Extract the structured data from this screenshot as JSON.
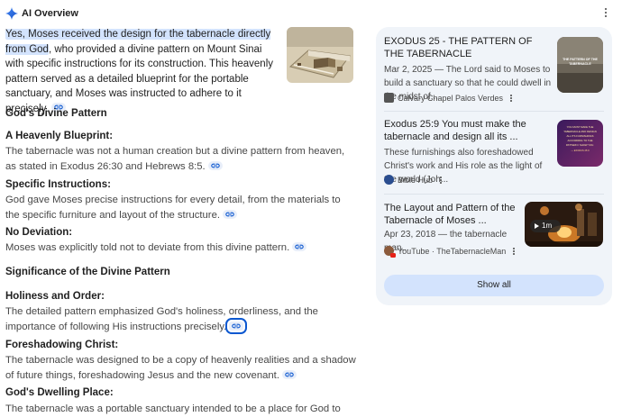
{
  "header": {
    "title": "AI Overview"
  },
  "intro": {
    "highlight": "Yes, Moses received the design for the tabernacle directly from God",
    "rest": ", who provided a divine pattern on Mount Sinai with specific instructions for its construction. This heavenly pattern served as a detailed blueprint for the portable sanctuary, and Moses was instructed to adhere to it precisely."
  },
  "sections": {
    "divine_pattern": {
      "heading": "God's Divine Pattern",
      "items": [
        {
          "title": "A Heavenly Blueprint:",
          "text": "The tabernacle was not a human creation but a divine pattern from heaven, as stated in Exodus 26:30 and Hebrews 8:5."
        },
        {
          "title": "Specific Instructions:",
          "text": "God gave Moses precise instructions for every detail, from the materials to the specific furniture and layout of the structure."
        },
        {
          "title": "No Deviation:",
          "text": "Moses was explicitly told not to deviate from this divine pattern."
        }
      ]
    },
    "significance": {
      "heading": "Significance of the Divine Pattern",
      "items": [
        {
          "title": "Holiness and Order:",
          "text": "The detailed pattern emphasized God's holiness, orderliness, and the importance of following His instructions precisely."
        },
        {
          "title": "Foreshadowing Christ:",
          "text": "The tabernacle was designed to be a copy of heavenly realities and a shadow of future things, foreshadowing Jesus and the new covenant."
        },
        {
          "title": "God's Dwelling Place:",
          "text": "The tabernacle was a portable sanctuary intended to be a place for God to dwell in the"
        }
      ]
    }
  },
  "sources": {
    "cards": [
      {
        "title": "EXODUS 25 - THE PATTERN OF THE TABERNACLE",
        "snippet": "Mar 2, 2025 — The Lord said to Moses to build a sanctuary so that he could dwell in the midst of...",
        "source": "Calvary Chapel Palos Verdes",
        "thumb_text": "THE PATTERN OF THE TABERNACLE"
      },
      {
        "title": "Exodus 25:9 You must make the tabernacle and design all its ...",
        "snippet": "These furnishings also foreshadowed Christ's work and His role as the light of the world (Joh...",
        "source": "Bible Hub",
        "thumb_text": "YOU MUST MAKE THE TABERNACLE AND DESIGN ALL ITS FURNISHINGS ACCORDING TO THE PATTERN I SHOW YOU. — EXODUS 25:9"
      },
      {
        "title": "The Layout and Pattern of the Tabernacle of Moses ...",
        "snippet": "Apr 23, 2018 — the tabernacle man...",
        "source": "YouTube · TheTabernacleMan",
        "duration": "1m"
      }
    ],
    "show_all": "Show all"
  },
  "colors": {
    "highlight": "#d3e3fd",
    "panel": "#f0f4f9",
    "accent": "#0b57d0"
  }
}
